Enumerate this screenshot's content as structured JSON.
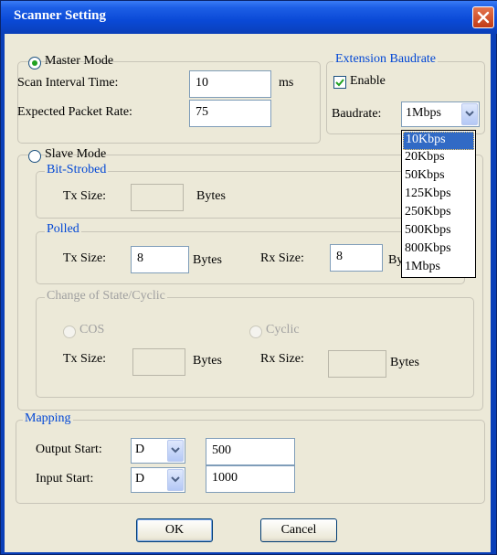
{
  "window": {
    "title": "Scanner Setting"
  },
  "master": {
    "label": "Master Mode",
    "scan_interval_label": "Scan Interval Time:",
    "scan_interval_value": "10",
    "scan_interval_unit": "ms",
    "packet_rate_label": "Expected Packet Rate:",
    "packet_rate_value": "75"
  },
  "baud": {
    "group_label": "Extension Baudrate",
    "enable_label": "Enable",
    "baudrate_label": "Baudrate:",
    "selected": "1Mbps",
    "options": [
      "10Kbps",
      "20Kbps",
      "50Kbps",
      "125Kbps",
      "250Kbps",
      "500Kbps",
      "800Kbps",
      "1Mbps"
    ]
  },
  "slave": {
    "label": "Slave Mode",
    "bitstrobed": {
      "label": "Bit-Strobed",
      "tx_label": "Tx Size:",
      "tx_value": "",
      "bytes": "Bytes"
    },
    "polled": {
      "label": "Polled",
      "tx_label": "Tx Size:",
      "tx_value": "8",
      "bytes": "Bytes",
      "rx_label": "Rx Size:",
      "rx_value": "8",
      "rx_bytes": "Bytes"
    },
    "cos": {
      "label": "Change of State/Cyclic",
      "cos_label": "COS",
      "cyclic_label": "Cyclic",
      "tx_label": "Tx Size:",
      "tx_value": "",
      "tx_bytes": "Bytes",
      "rx_label": "Rx Size:",
      "rx_value": "",
      "rx_bytes": "Bytes"
    }
  },
  "mapping": {
    "label": "Mapping",
    "output_label": "Output Start:",
    "output_device": "D",
    "output_value": "500",
    "input_label": "Input Start:",
    "input_device": "D",
    "input_value": "1000"
  },
  "buttons": {
    "ok": "OK",
    "cancel": "Cancel"
  },
  "colors": {
    "title_bar": "#0a49d6",
    "group_label": "#0046d5",
    "selection": "#316ac5"
  }
}
